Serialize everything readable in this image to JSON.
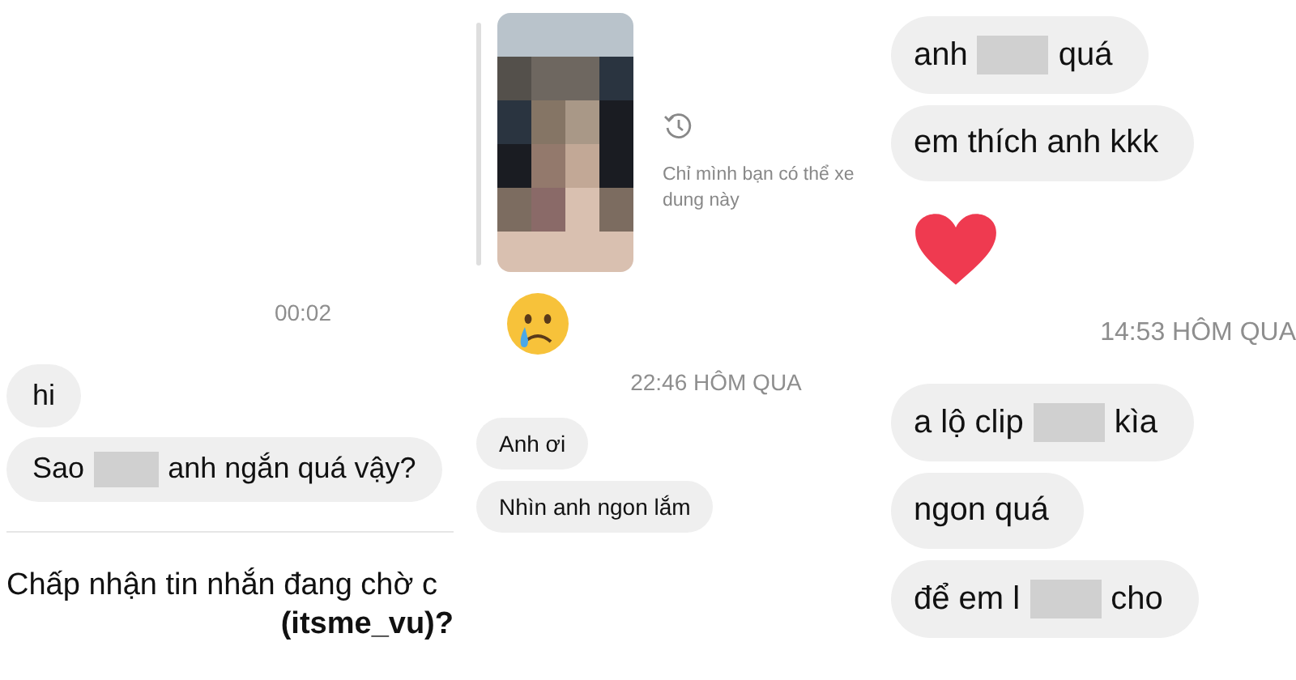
{
  "panels": [
    {
      "items": [
        {
          "kind": "time",
          "text": "00:02"
        },
        {
          "kind": "bubble",
          "parts": [
            {
              "kind": "text",
              "text": "hi"
            }
          ]
        },
        {
          "kind": "bubble",
          "parts": [
            {
              "kind": "text",
              "text": "Sao"
            },
            {
              "kind": "redacted"
            },
            {
              "kind": "text",
              "text": "anh ngắn quá vậy?"
            }
          ]
        },
        {
          "kind": "prompt",
          "text": "Chấp nhận tin nhắn đang chờ c",
          "handle": "(itsme_vu)?"
        }
      ]
    },
    {
      "items": [
        {
          "note": "Chỉ mình bạn có thể xe dung này"
        },
        {
          "kind": "emoji"
        },
        {
          "kind": "time",
          "text": "22:46 HÔM QUA"
        },
        {
          "kind": "bubble",
          "parts": [
            {
              "kind": "text",
              "text": "Anh ơi"
            }
          ]
        },
        {
          "kind": "bubble",
          "parts": [
            {
              "kind": "text",
              "text": "Nhìn anh ngon lắm"
            }
          ]
        }
      ]
    },
    {
      "items": [
        {
          "kind": "bubble",
          "parts": [
            {
              "kind": "text",
              "text": "anh"
            },
            {
              "kind": "redacted"
            },
            {
              "kind": "text",
              "text": "quá"
            }
          ]
        },
        {
          "kind": "bubble",
          "parts": [
            {
              "kind": "text",
              "text": "em thích anh kkk"
            }
          ]
        },
        {
          "kind": "heart"
        },
        {
          "kind": "time",
          "text": "14:53 HÔM QUA"
        },
        {
          "kind": "bubble",
          "parts": [
            {
              "kind": "text",
              "text": "a lộ clip"
            },
            {
              "kind": "redacted"
            },
            {
              "kind": "text",
              "text": "kìa"
            }
          ]
        },
        {
          "kind": "bubble",
          "parts": [
            {
              "kind": "text",
              "text": "ngon quá"
            }
          ]
        },
        {
          "kind": "bubble",
          "parts": [
            {
              "kind": "text",
              "text": "để em l"
            },
            {
              "kind": "redacted"
            },
            {
              "kind": "text",
              "text": "cho"
            }
          ]
        }
      ]
    }
  ]
}
